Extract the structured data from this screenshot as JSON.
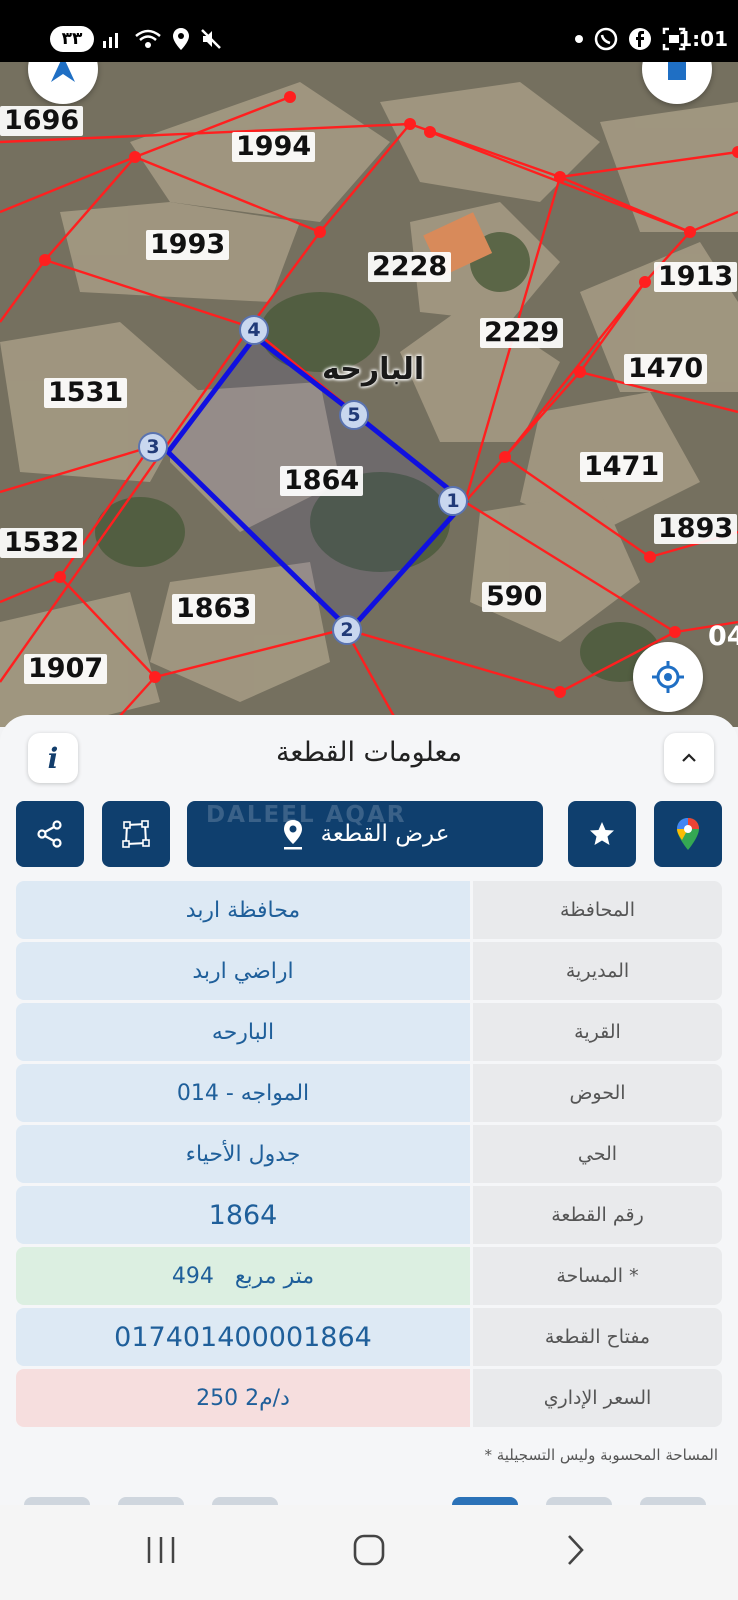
{
  "status_bar": {
    "notification_count": "٣٣",
    "time": "1:01",
    "icons_left": [
      "signal-bars-icon",
      "wifi-icon",
      "location-icon",
      "mute-icon"
    ],
    "icons_right": [
      "dot-icon",
      "whatsapp-icon",
      "facebook-icon",
      "screenshot-icon"
    ]
  },
  "map": {
    "village_label": "البارحه",
    "plots": [
      "1696",
      "1994",
      "1993",
      "2228",
      "1913",
      "2229",
      "1470",
      "1531",
      "1864",
      "1471",
      "1893",
      "1532",
      "590",
      "1863",
      "1907"
    ],
    "partial_plot": "04",
    "vertices": [
      "1",
      "2",
      "3",
      "4",
      "5"
    ],
    "colors": {
      "parcel_lines": "#ff1f1f",
      "selected_parcel": "#1010e0"
    }
  },
  "sheet": {
    "title": "معلومات القطعة",
    "info_label": "i",
    "show_parcel_label": "عرض القطعة",
    "watermark": "DALEEL AQAR",
    "rows": [
      {
        "key": "المحافظة",
        "value": "محافظة اربد"
      },
      {
        "key": "المديرية",
        "value": "اراضي اربد"
      },
      {
        "key": "القرية",
        "value": "البارحه"
      },
      {
        "key": "الحوض",
        "value": "المواجه - 014"
      },
      {
        "key": "الحي",
        "value": "جدول الأحياء"
      },
      {
        "key": "رقم القطعة",
        "value": "1864"
      },
      {
        "key": "المساحة *",
        "value": "494   متر مربع"
      },
      {
        "key": "مفتاح القطعة",
        "value": "017401400001864"
      },
      {
        "key": "السعر الإداري",
        "value": "250 د/م2"
      }
    ],
    "note": "* المساحة المحسوبة وليس التسجيلية",
    "colors": {
      "primary": "#0f3f6e",
      "value_blue": "#dde9f4",
      "value_green": "#dcefe1",
      "value_red": "#f6dede"
    }
  }
}
